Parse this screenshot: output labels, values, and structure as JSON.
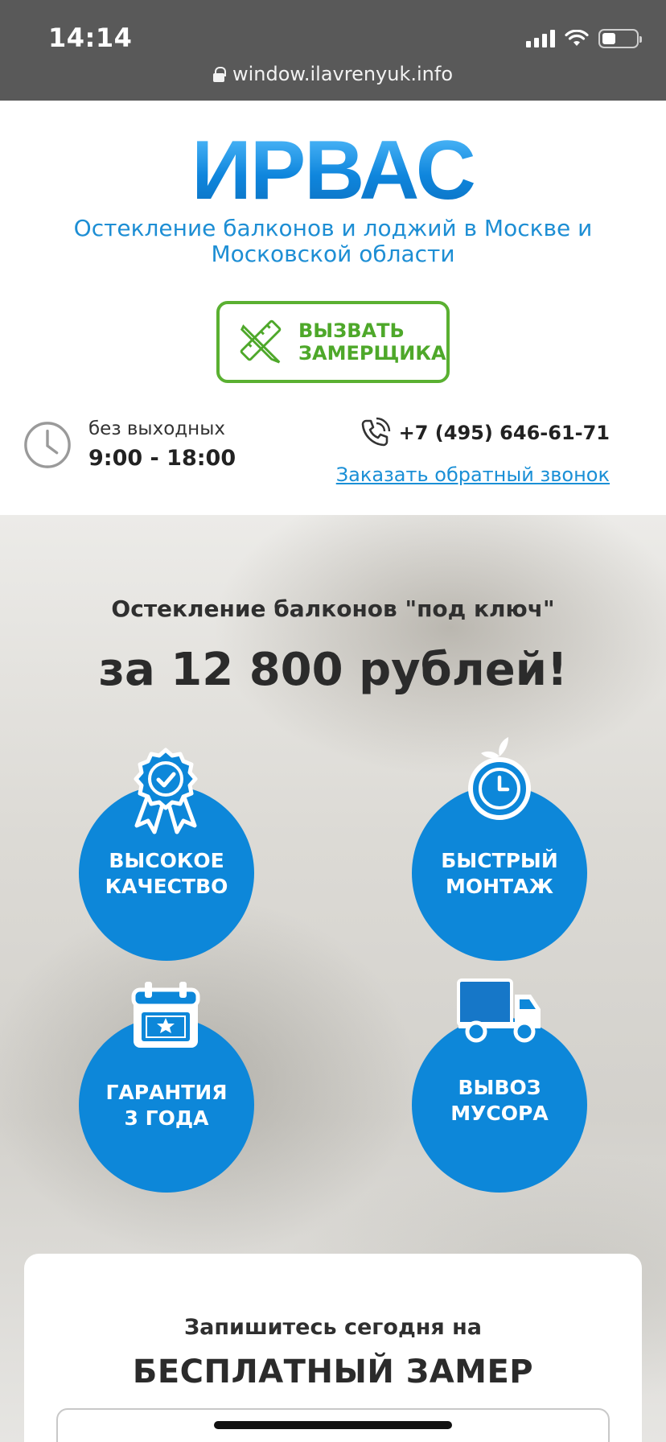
{
  "status_bar": {
    "time": "14:14",
    "url": "window.ilavrenyuk.info",
    "battery_level": 0.4
  },
  "header": {
    "logo_text": "ИРВАС",
    "subtitle": "Остекление балконов и лоджий в Москве и Московской области",
    "cta_label_1": "ВЫЗВАТЬ",
    "cta_label_2": "ЗАМЕРЩИКА",
    "schedule_label": "без выходных",
    "schedule_hours": "9:00 - 18:00",
    "phone": "+7 (495) 646-61-71",
    "callback_link": "Заказать обратный звонок"
  },
  "hero": {
    "line1": "Остекление балконов \"под ключ\"",
    "line2": "за 12 800 рублей!",
    "features": [
      {
        "line1": "ВЫСОКОЕ",
        "line2": "КАЧЕСТВО",
        "icon": "award-badge-icon"
      },
      {
        "line1": "БЫСТРЫЙ",
        "line2": "МОНТАЖ",
        "icon": "stopwatch-icon"
      },
      {
        "line1": "ГАРАНТИЯ",
        "line2": "3 ГОДА",
        "icon": "calendar-star-icon"
      },
      {
        "line1": "ВЫВОЗ",
        "line2": "МУСОРА",
        "icon": "truck-icon"
      }
    ]
  },
  "form": {
    "line1": "Запишитесь сегодня на",
    "line2": "БЕСПЛАТНЫЙ ЗАМЕР"
  },
  "colors": {
    "brand_blue": "#0d87d9",
    "cta_green": "#5ab031",
    "link_blue": "#1a8fd6"
  }
}
